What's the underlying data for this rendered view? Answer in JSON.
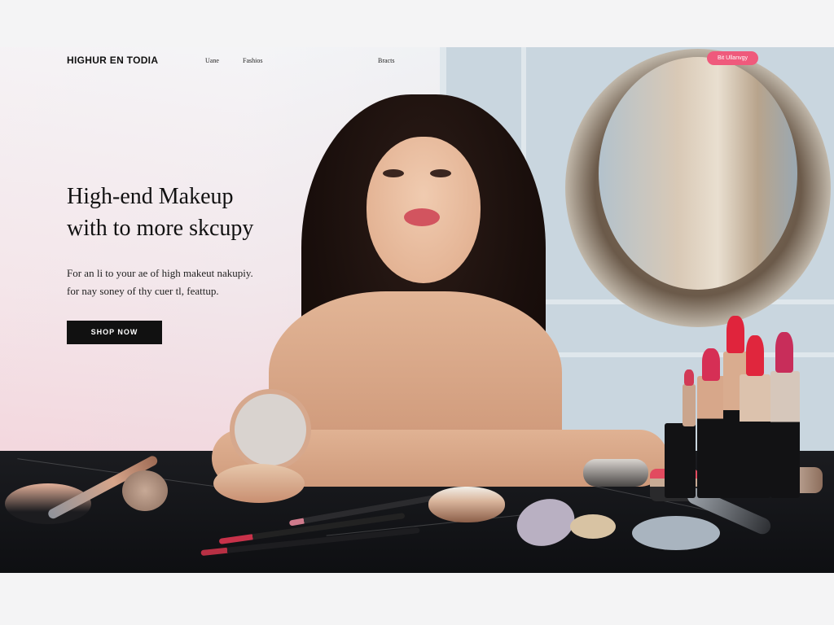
{
  "brand": {
    "logo": "HIGHUR EN TODIA"
  },
  "nav": {
    "links": [
      "Uane",
      "Fashios",
      "Bracts"
    ],
    "cta": "Bit Ullanvgy"
  },
  "hero": {
    "headline_line1": "High-end Makeup",
    "headline_line2": "with to more skcupy",
    "subtext_line1": "For an li to your ae of high makeut nakupiy.",
    "subtext_line2": "for nay soney of thy cuer tl, feattup.",
    "shop_button": "SHOP NOW"
  },
  "colors": {
    "accent": "#ef5a7c",
    "button": "#111111",
    "background_left": "#f3e6ea",
    "background_right": "#c9d6df",
    "counter": "#111216"
  },
  "icons": [
    "mirror-image",
    "model-image",
    "lipstick-image",
    "compact-image",
    "makeup-brush-image",
    "sponge-image"
  ]
}
